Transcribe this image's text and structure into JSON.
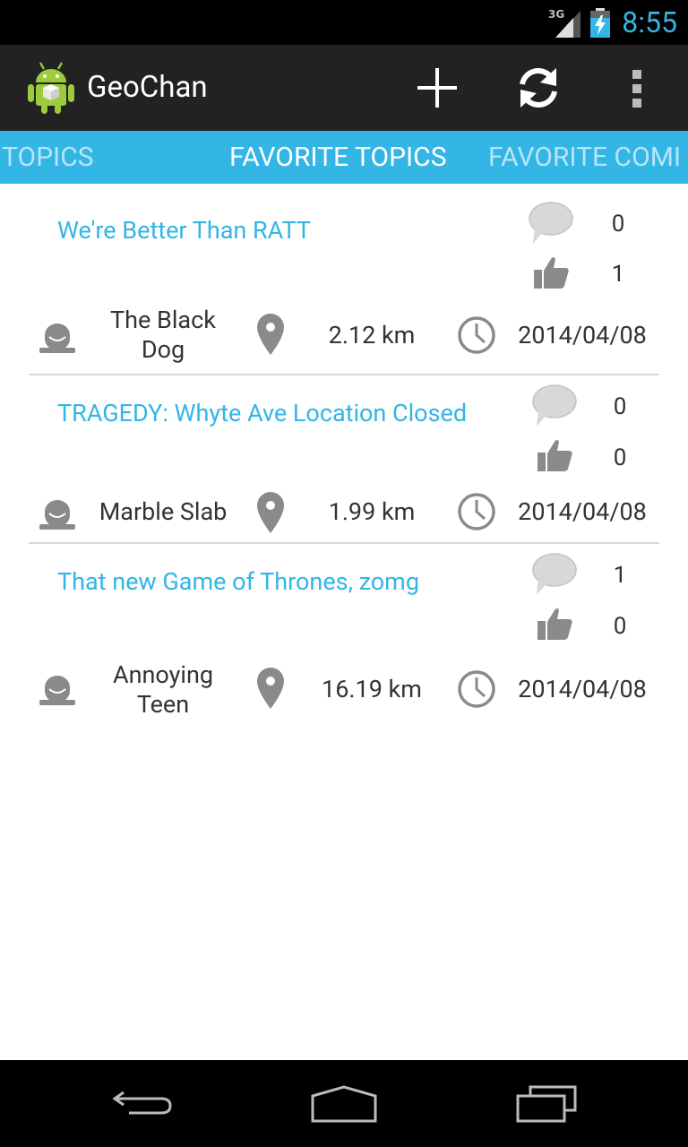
{
  "status_bar": {
    "network": "3G",
    "time": "8:55"
  },
  "action_bar": {
    "title": "GeoChan",
    "actions": [
      "add-icon",
      "refresh-icon",
      "overflow-menu-icon"
    ]
  },
  "tabs": [
    "TOPICS",
    "FAVORITE TOPICS",
    "FAVORITE COMMENTS"
  ],
  "tab_visible_text": [
    "TOPICS",
    "FAVORITE TOPICS",
    "FAVORITE COMI"
  ],
  "selected_tab": "FAVORITE TOPICS",
  "topics": [
    {
      "title": "We're Better Than RATT",
      "comments": "0",
      "likes": "1",
      "author": "The Black Dog",
      "distance": "2.12 km",
      "date": "2014/04/08"
    },
    {
      "title": "TRAGEDY: Whyte Ave Location Closed",
      "comments": "0",
      "likes": "0",
      "author": "Marble Slab",
      "distance": "1.99 km",
      "date": "2014/04/08"
    },
    {
      "title": "That new Game of Thrones, zomg",
      "comments": "1",
      "likes": "0",
      "author": "Annoying Teen",
      "distance": "16.19 km",
      "date": "2014/04/08"
    }
  ],
  "colors": {
    "accent": "#33b5e5",
    "action_bar": "#222222",
    "icon_gray": "#8a8a8a"
  },
  "nav": [
    "back-icon",
    "home-icon",
    "recent-apps-icon"
  ]
}
